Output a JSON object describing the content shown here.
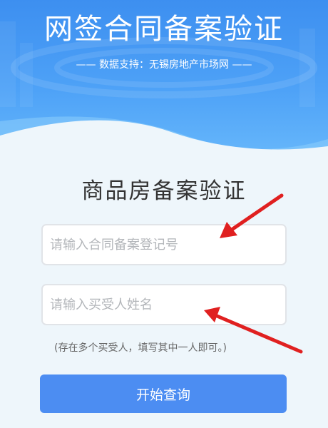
{
  "header": {
    "title": "网签合同备案验证",
    "source_line": "—— 数据支持：无锡房地产市场网 ——"
  },
  "form": {
    "title": "商品房备案验证",
    "contract_placeholder": "请输入合同备案登记号",
    "buyer_placeholder": "请输入买受人姓名",
    "hint": "(存在多个买受人，填写其中一人即可。)",
    "submit_label": "开始查询"
  },
  "colors": {
    "header_blue": "#3d8ff0",
    "button_blue": "#4c8df2",
    "arrow_red": "#e02020"
  }
}
